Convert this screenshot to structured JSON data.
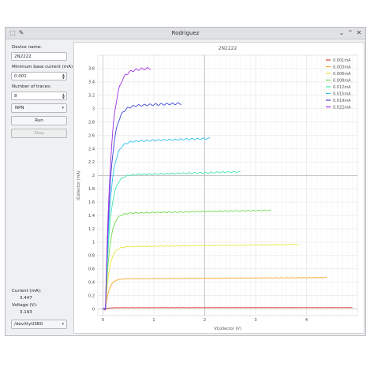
{
  "window": {
    "title": "Rodriguez"
  },
  "sidebar": {
    "device_name_label": "Device name:",
    "device_name_value": "2N2222",
    "min_base_current_label": "Minimum base current (mA)",
    "min_base_current_value": "0.001",
    "num_traces_label": "Number of traces:",
    "num_traces_value": "8",
    "transistor_type_value": "NPN",
    "run_label": "Run",
    "stop_label": "Stop",
    "current_label": "Current (mA):",
    "current_value": "3.447",
    "voltage_label": "Voltage (V):",
    "voltage_value": "3.193",
    "port_value": "/dev/ttyUSB0"
  },
  "colors": {
    "grid": "#e8e8e8",
    "axis": "#333333"
  },
  "chart_data": {
    "type": "line",
    "title": "2N2222",
    "xlabel": "VCollector (V)",
    "ylabel": "ICollector (mA)",
    "xlim": [
      -0.1,
      5.0
    ],
    "ylim": [
      -0.1,
      3.8
    ],
    "x_ticks": [
      0,
      1,
      2,
      3,
      4
    ],
    "y_ticks": [
      0,
      0.2,
      0.4,
      0.6,
      0.8,
      1,
      1.2,
      1.4,
      1.6,
      1.8,
      2,
      2.2,
      2.4,
      2.6,
      2.8,
      3,
      3.2,
      3.4,
      3.6
    ],
    "grid": true,
    "legend_position": "top-right",
    "series": [
      {
        "name": "0.001mA",
        "color": "#e03b2f",
        "sat_current": 0.02,
        "end_voltage": 4.9
      },
      {
        "name": "0.003mA",
        "color": "#f7a42a",
        "sat_current": 0.45,
        "end_voltage": 4.4
      },
      {
        "name": "0.006mA",
        "color": "#e3ea40",
        "sat_current": 0.93,
        "end_voltage": 3.85
      },
      {
        "name": "0.008mA",
        "color": "#6fdc4a",
        "sat_current": 1.43,
        "end_voltage": 3.3
      },
      {
        "name": "0.012mA",
        "color": "#3fe6b0",
        "sat_current": 2.0,
        "end_voltage": 2.7
      },
      {
        "name": "0.015mA",
        "color": "#2fc0ee",
        "sat_current": 2.5,
        "end_voltage": 2.1
      },
      {
        "name": "0.019mA",
        "color": "#3b45d6",
        "sat_current": 3.03,
        "end_voltage": 1.55
      },
      {
        "name": "0.022mA",
        "color": "#a32fe3",
        "sat_current": 3.57,
        "end_voltage": 0.95
      }
    ]
  }
}
